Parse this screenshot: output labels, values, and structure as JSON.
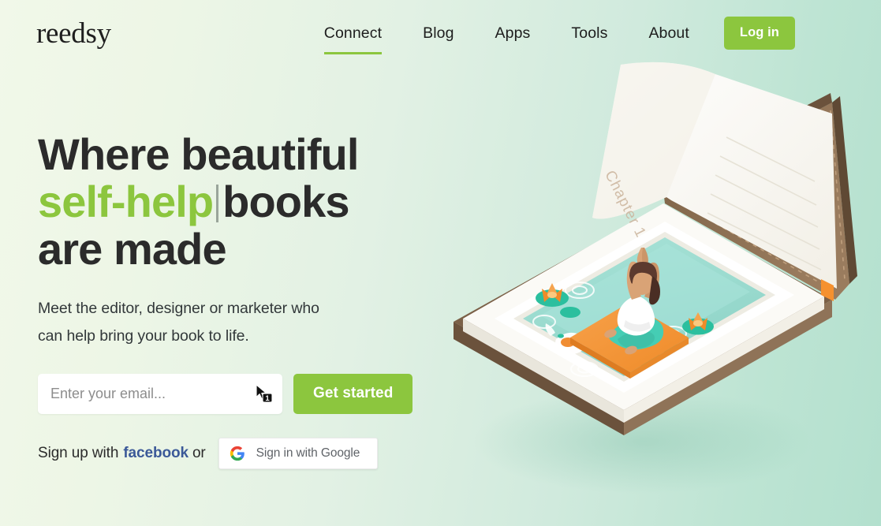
{
  "brand": {
    "logo_text": "reedsy",
    "accent_green": "#8cc63e",
    "facebook_blue": "#3b5998",
    "background_from": "#f1f8e9",
    "background_to": "#b3e0ce"
  },
  "header": {
    "nav_items": [
      {
        "label": "Connect",
        "active": true
      },
      {
        "label": "Blog",
        "active": false
      },
      {
        "label": "Apps",
        "active": false
      },
      {
        "label": "Tools",
        "active": false
      },
      {
        "label": "About",
        "active": false
      }
    ],
    "login_label": "Log in"
  },
  "hero": {
    "headline": {
      "line1": "Where beautiful",
      "line2_highlight": "self-help",
      "line2_rest": "books",
      "line3": "are made"
    },
    "subheadline_line1": "Meet the editor, designer or marketer who",
    "subheadline_line2": "can help bring your book to life.",
    "email_placeholder": "Enter your email...",
    "email_value": "",
    "cta_label": "Get started",
    "cursor_badge_number": "1",
    "social": {
      "prefix": "Sign up with",
      "facebook_label": "facebook",
      "or": "or",
      "google_label": "Sign in with Google"
    }
  },
  "illustration": {
    "chapter_text": "Chapter 1",
    "alt": "Isometric open book containing a koi pond with a woman meditating on an orange yoga mat",
    "colors": {
      "book_cover": "#8a6e53",
      "page_white": "#fbfaf6",
      "water": "#9fdcd2",
      "mat_orange": "#f5912f",
      "lotus_orange": "#f08d33",
      "lily_green": "#2bbf9e",
      "pants_teal": "#45cdb4",
      "skin": "#d9a376",
      "hair": "#5c3a2e"
    }
  }
}
